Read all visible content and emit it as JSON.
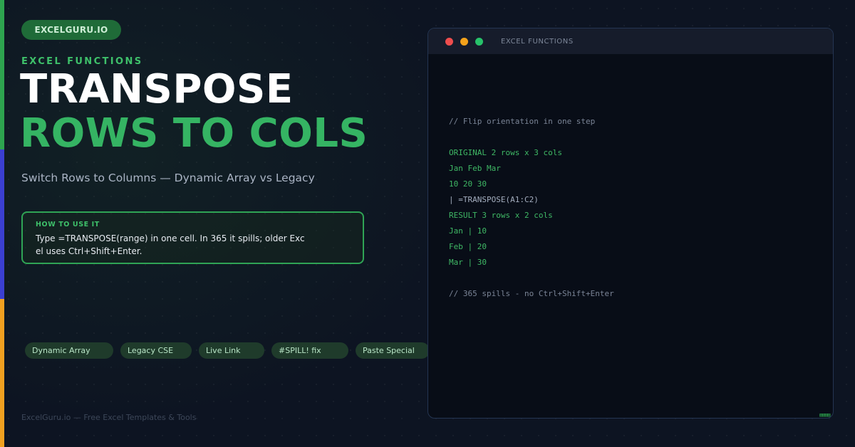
{
  "brand": {
    "label": "EXCELGURU.IO"
  },
  "hero": {
    "eyebrow": "EXCEL FUNCTIONS",
    "title_line1": "TRANSPOSE",
    "title_line2": "ROWS TO COLS",
    "subtitle": "Switch Rows to Columns — Dynamic Array vs Legacy"
  },
  "howto": {
    "label": "HOW TO USE IT",
    "body": "Type =TRANSPOSE(range) in one cell. In 365 it spills; older Excel uses Ctrl+Shift+Enter."
  },
  "tags": [
    "Dynamic Array",
    "Legacy CSE",
    "Live Link",
    "#SPILL! fix",
    "Paste Special"
  ],
  "footer": {
    "text": "ExcelGuru.io — Free Excel Templates & Tools"
  },
  "window": {
    "title": "EXCEL FUNCTIONS",
    "badge": "▧▧▧▧",
    "code_lines": [
      "// Flip orientation in one step",
      "",
      "ORIGINAL 2 rows x 3 cols",
      "Jan Feb Mar",
      "10 20 30",
      "| =TRANSPOSE(A1:C2)",
      "RESULT 3 rows x 2 cols",
      "Jan | 10",
      "Feb | 20",
      "Mar | 30",
      "",
      "// 365 spills - no Ctrl+Shift+Enter"
    ]
  },
  "colors": {
    "accent_green": "#2ea44f",
    "accent_blue": "#3b3fd1",
    "accent_orange": "#f0a020",
    "background": "#0d1422"
  }
}
